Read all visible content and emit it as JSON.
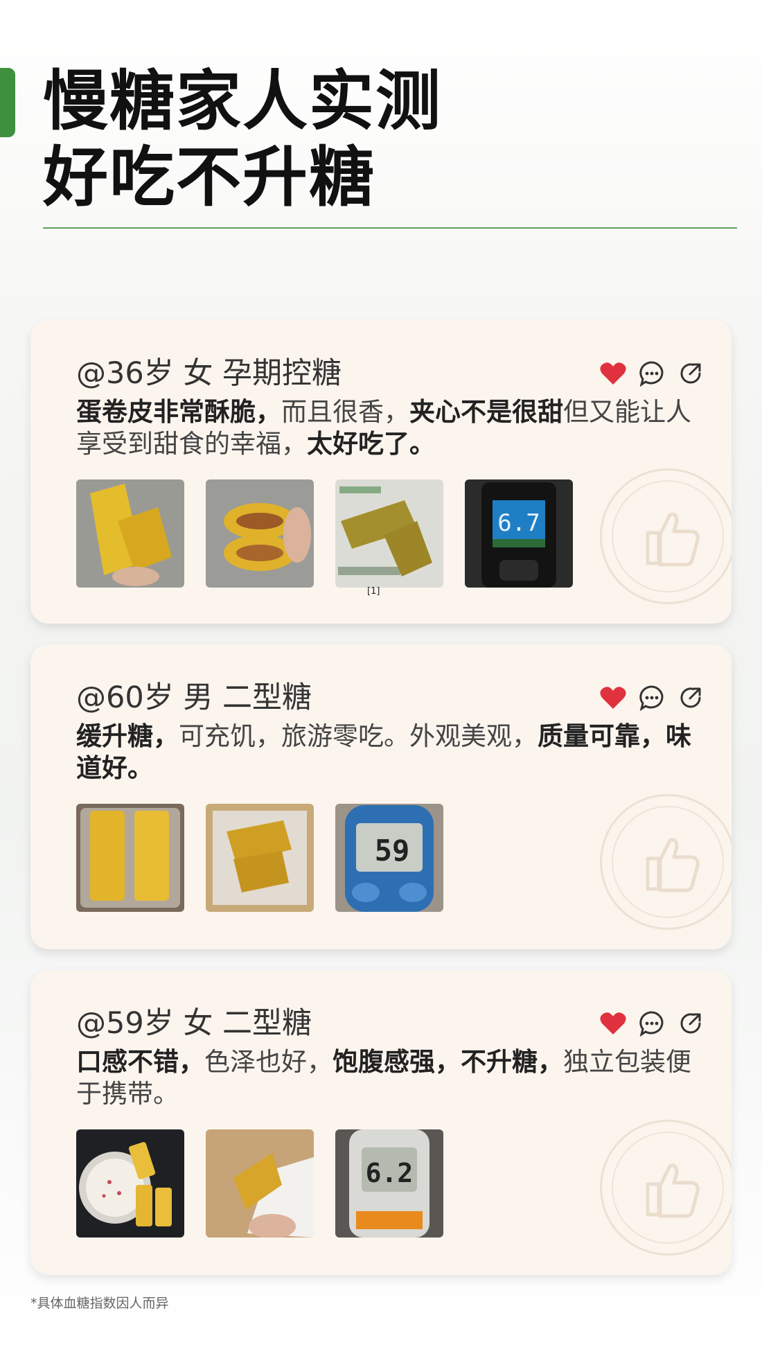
{
  "header": {
    "title_line1": "慢糖家人实测",
    "title_line2": "好吃不升糖"
  },
  "icons": {
    "like": "heart-icon",
    "comment": "comment-icon",
    "share": "share-icon",
    "watermark": "thumbs-up-icon"
  },
  "colors": {
    "accent": "#3e8f3e",
    "heart": "#e0323e",
    "card_bg": "#fbf5ee"
  },
  "reviews": [
    {
      "user": "@36岁 女 孕期控糖",
      "comment_parts": [
        {
          "text": "蛋卷皮非常酥脆，",
          "bold": true
        },
        {
          "text": "而且很香，",
          "bold": false
        },
        {
          "text": "夹心不是很甜",
          "bold": true
        },
        {
          "text": "但又能让人享受到甜食的幸福，",
          "bold": false
        },
        {
          "text": "太好吃了。",
          "bold": true
        }
      ],
      "photos": [
        {
          "subject": "egg roll in hand",
          "label": ""
        },
        {
          "subject": "egg roll filling",
          "label": ""
        },
        {
          "subject": "egg roll on package",
          "label": ""
        },
        {
          "subject": "glucose meter",
          "label": "6.7"
        }
      ],
      "ref_mark": "[1]"
    },
    {
      "user": "@60岁 男 二型糖",
      "comment_parts": [
        {
          "text": "缓升糖，",
          "bold": true
        },
        {
          "text": "可充饥，旅游零吃。外观美观，",
          "bold": false
        },
        {
          "text": "质量可靠，味道好。",
          "bold": true
        }
      ],
      "photos": [
        {
          "subject": "egg rolls in tray",
          "label": ""
        },
        {
          "subject": "egg rolls in bag",
          "label": ""
        },
        {
          "subject": "glucose meter",
          "label": "59"
        }
      ]
    },
    {
      "user": "@59岁 女 二型糖",
      "comment_parts": [
        {
          "text": "口感不错，",
          "bold": true
        },
        {
          "text": "色泽也好，",
          "bold": false
        },
        {
          "text": "饱腹感强，不升糖，",
          "bold": true
        },
        {
          "text": "独立包装便于携带。",
          "bold": false
        }
      ],
      "photos": [
        {
          "subject": "egg rolls with milk",
          "label": ""
        },
        {
          "subject": "egg roll in wrapper",
          "label": ""
        },
        {
          "subject": "glucose meter",
          "label": "6.2"
        }
      ]
    }
  ],
  "footnote": "*具体血糖指数因人而异"
}
